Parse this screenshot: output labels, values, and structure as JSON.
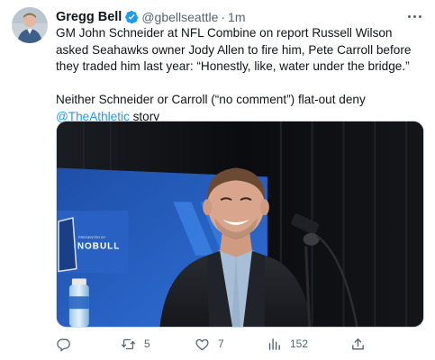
{
  "author": {
    "display_name": "Gregg Bell",
    "handle": "@gbellseattle",
    "separator": "·",
    "time": "1m",
    "verified_color": "#1d9bf0"
  },
  "tweet": {
    "paragraph1": "GM John Schneider at NFL Combine on report Russell Wilson asked Seahawks owner Jody Allen to fire him, Pete Carroll before they traded him last year: “Honestly, like, water under the bridge.”",
    "paragraph2_before": "Neither Schneider or Carroll (“no comment”) flat-out deny ",
    "mention": "@TheAthletic",
    "paragraph2_after": " story"
  },
  "media": {
    "backdrop_text": "NOBULL",
    "backdrop_small_text": "PRESENTED BY"
  },
  "actions": {
    "reply_icon": "reply-icon",
    "retweet_icon": "retweet-icon",
    "retweet_count": "5",
    "like_icon": "heart-icon",
    "like_count": "7",
    "views_icon": "views-icon",
    "views_count": "152",
    "share_icon": "share-icon"
  },
  "colors": {
    "text": "#0f1419",
    "secondary": "#536471",
    "link": "#1d9bf0"
  }
}
